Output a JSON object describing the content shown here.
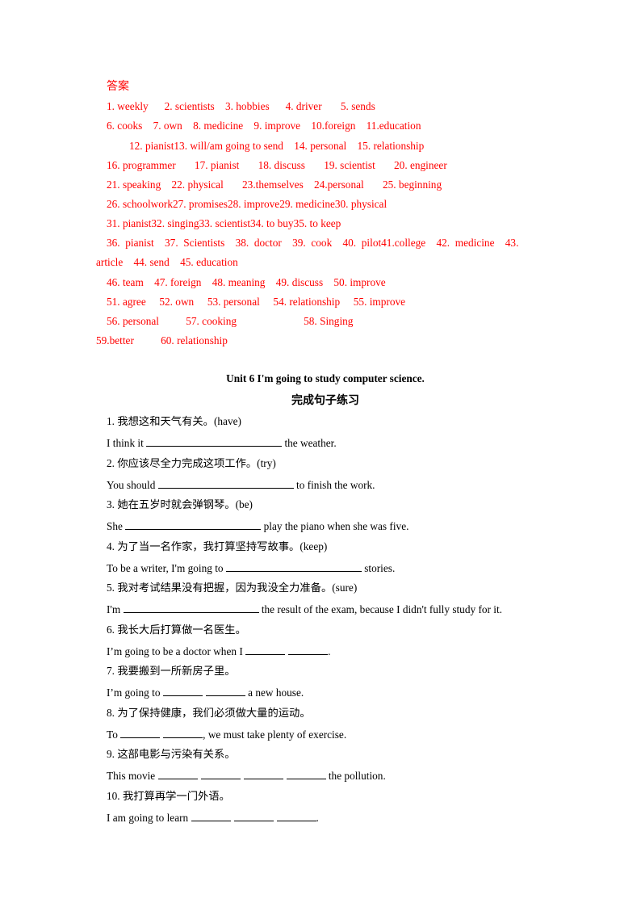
{
  "answers": {
    "title": "答案",
    "lines": [
      "1. weekly      2. scientists    3. hobbies      4. driver       5. sends",
      "6. cooks    7. own    8. medicine    9. improve    10.foreign    11.education",
      "12. pianist13. will/am going to send    14. personal    15. relationship",
      "16. programmer       17. pianist       18. discuss       19. scientist       20. engineer",
      "21. speaking    22. physical       23.themselves    24.personal       25. beginning",
      "26. schoolwork27. promises28. improve29. medicine30. physical",
      "31. pianist32. singing33. scientist34. to buy35. to keep",
      "36.  pianist    37.  Scientists    38.  doctor    39.  cook    40.  pilot41.college    42.  medicine    43.",
      "article    44. send    45. education",
      "46. team    47. foreign    48. meaning    49. discuss    50. improve",
      "51. agree     52. own     53. personal     54. relationship     55. improve",
      "56. personal          57. cooking                         58. Singing",
      "59.better          60. relationship"
    ]
  },
  "exercise": {
    "unit_title": "Unit 6 I'm going to study computer science.",
    "section_title": "完成句子练习",
    "items": [
      {
        "num": "1.",
        "cn": "我想这和天气有关。",
        "hint": "(have)",
        "before": "I think it ",
        "blanks": 1,
        "after": " the weather."
      },
      {
        "num": "2.",
        "cn": "你应该尽全力完成这项工作。",
        "hint": "(try)",
        "before": "You should ",
        "blanks": 1,
        "after": " to finish the work."
      },
      {
        "num": "3.",
        "cn": "她在五岁时就会弹钢琴。",
        "hint": "(be)",
        "before": "She ",
        "blanks": 1,
        "after": " play the piano when she was five."
      },
      {
        "num": "4.",
        "cn": "为了当一名作家，我打算坚持写故事。",
        "hint": "(keep)",
        "before": "To be a writer, I'm going to ",
        "blanks": 1,
        "after": " stories."
      },
      {
        "num": "5.",
        "cn": "我对考试结果没有把握，因为我没全力准备。",
        "hint": "(sure)",
        "before": "I'm ",
        "blanks": 1,
        "after": " the result of the exam, because I didn't fully study for it."
      },
      {
        "num": "6.",
        "cn": "我长大后打算做一名医生。",
        "hint": "",
        "before": "I’m going to be a doctor when I ",
        "blanks": 2,
        "after": "."
      },
      {
        "num": "7.",
        "cn": "我要搬到一所新房子里。",
        "hint": "",
        "before": "I’m going to ",
        "blanks": 2,
        "after": " a new house."
      },
      {
        "num": "8.",
        "cn": "为了保持健康，我们必须做大量的运动。",
        "hint": "",
        "before": "To ",
        "blanks": 2,
        "after": ", we must take plenty of exercise."
      },
      {
        "num": "9.",
        "cn": "这部电影与污染有关系。",
        "hint": "",
        "before": "This movie ",
        "blanks": 4,
        "after": " the pollution."
      },
      {
        "num": "10.",
        "cn": "我打算再学一门外语。",
        "hint": "",
        "before": "I am going to learn ",
        "blanks": 3,
        "after": "."
      }
    ]
  }
}
